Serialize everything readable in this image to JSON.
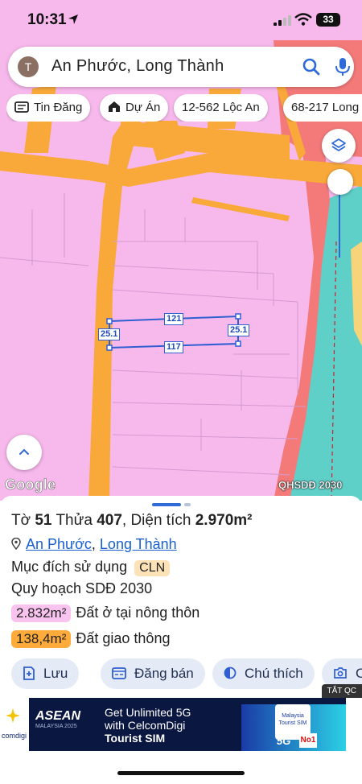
{
  "status_bar": {
    "time": "10:31",
    "battery": "33"
  },
  "search": {
    "avatar_letter": "T",
    "query": "An Phước, Long Thành"
  },
  "chips": [
    {
      "label": "Tin Đăng",
      "icon": "listing-card-icon"
    },
    {
      "label": "Dự Án",
      "icon": "house-icon"
    },
    {
      "label": "12-562 Lộc An",
      "icon": ""
    },
    {
      "label": "68-217 Long",
      "icon": ""
    }
  ],
  "map": {
    "google_label": "Google",
    "layer_label": "QHSDĐ 2030",
    "parcel_dimensions": {
      "top": "121",
      "bottom": "117",
      "left": "25.1",
      "right": "25.1"
    },
    "colors": {
      "residential_land": "#f7b8ec",
      "road": "#f8a93a",
      "water": "#5fd0c8",
      "parcel_outline": "#2f5fd0"
    }
  },
  "info": {
    "title": {
      "to_label": "Tờ",
      "to_value": "51",
      "thua_label": "Thửa",
      "thua_value": "407",
      "area_label": "Diện tích",
      "area_value": "2.970m²"
    },
    "address": {
      "ward": "An Phước",
      "separator": ",",
      "district": "Long Thành"
    },
    "purpose": {
      "label": "Mục đích sử dụng",
      "code": "CLN"
    },
    "plan": "Quy hoạch SDĐ 2030",
    "areas": [
      {
        "value": "2.832m²",
        "label": "Đất ở tại nông thôn",
        "color": "#f8c3ef"
      },
      {
        "value": "138,4m²",
        "label": "Đất giao thông",
        "color": "#ffab3c"
      }
    ]
  },
  "actions": [
    {
      "label": "Lưu",
      "icon": "save-icon"
    },
    {
      "label": "Đăng bán",
      "icon": "post-listing-icon"
    },
    {
      "label": "Chú thích",
      "icon": "legend-icon"
    },
    {
      "label": "C",
      "icon": "camera-icon"
    }
  ],
  "ad": {
    "close_label": "TẮT QC",
    "brand": "comdigi",
    "asean": "ASEAN",
    "asean_sub": "MALAYSIA 2025",
    "line1": "Get Unlimited 5G",
    "line2": "with CelcomDigi",
    "line3": "Tourist SIM",
    "sim_card_text": "Malaysia Tourist SIM",
    "fiveg": "5G",
    "no1": "No1"
  }
}
